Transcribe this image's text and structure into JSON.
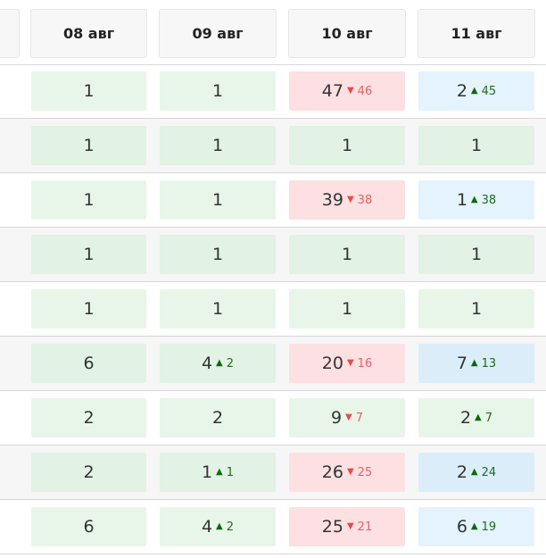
{
  "header": {
    "columns": [
      "08 авг",
      "09 авг",
      "10 авг",
      "11 авг"
    ]
  },
  "colors": {
    "green": "#e8f6e9",
    "green_alt": "#e2f2e4",
    "red": "#fde0e2",
    "blue": "#e4f3fd",
    "blue_alt": "#dbedf9"
  },
  "rows": [
    {
      "cells": [
        {
          "value": "1",
          "color": "green"
        },
        {
          "value": "1",
          "color": "green"
        },
        {
          "value": "47",
          "color": "red",
          "delta": "46",
          "dir": "down"
        },
        {
          "value": "2",
          "color": "blue",
          "delta": "45",
          "dir": "up"
        }
      ]
    },
    {
      "cells": [
        {
          "value": "1",
          "color": "green"
        },
        {
          "value": "1",
          "color": "green"
        },
        {
          "value": "1",
          "color": "green"
        },
        {
          "value": "1",
          "color": "green"
        }
      ]
    },
    {
      "cells": [
        {
          "value": "1",
          "color": "green"
        },
        {
          "value": "1",
          "color": "green"
        },
        {
          "value": "39",
          "color": "red",
          "delta": "38",
          "dir": "down"
        },
        {
          "value": "1",
          "color": "blue",
          "delta": "38",
          "dir": "up"
        }
      ]
    },
    {
      "cells": [
        {
          "value": "1",
          "color": "green"
        },
        {
          "value": "1",
          "color": "green"
        },
        {
          "value": "1",
          "color": "green"
        },
        {
          "value": "1",
          "color": "green"
        }
      ]
    },
    {
      "cells": [
        {
          "value": "1",
          "color": "green"
        },
        {
          "value": "1",
          "color": "green"
        },
        {
          "value": "1",
          "color": "green"
        },
        {
          "value": "1",
          "color": "green"
        }
      ]
    },
    {
      "cells": [
        {
          "value": "6",
          "color": "green"
        },
        {
          "value": "4",
          "color": "green",
          "delta": "2",
          "dir": "up"
        },
        {
          "value": "20",
          "color": "red",
          "delta": "16",
          "dir": "down"
        },
        {
          "value": "7",
          "color": "blue",
          "delta": "13",
          "dir": "up"
        }
      ]
    },
    {
      "cells": [
        {
          "value": "2",
          "color": "green"
        },
        {
          "value": "2",
          "color": "green"
        },
        {
          "value": "9",
          "color": "green",
          "delta": "7",
          "dir": "down"
        },
        {
          "value": "2",
          "color": "green",
          "delta": "7",
          "dir": "up"
        }
      ]
    },
    {
      "cells": [
        {
          "value": "2",
          "color": "green"
        },
        {
          "value": "1",
          "color": "green",
          "delta": "1",
          "dir": "up"
        },
        {
          "value": "26",
          "color": "red",
          "delta": "25",
          "dir": "down"
        },
        {
          "value": "2",
          "color": "blue",
          "delta": "24",
          "dir": "up"
        }
      ]
    },
    {
      "cells": [
        {
          "value": "6",
          "color": "green"
        },
        {
          "value": "4",
          "color": "green",
          "delta": "2",
          "dir": "up"
        },
        {
          "value": "25",
          "color": "red",
          "delta": "21",
          "dir": "down"
        },
        {
          "value": "6",
          "color": "blue",
          "delta": "19",
          "dir": "up"
        }
      ]
    }
  ]
}
